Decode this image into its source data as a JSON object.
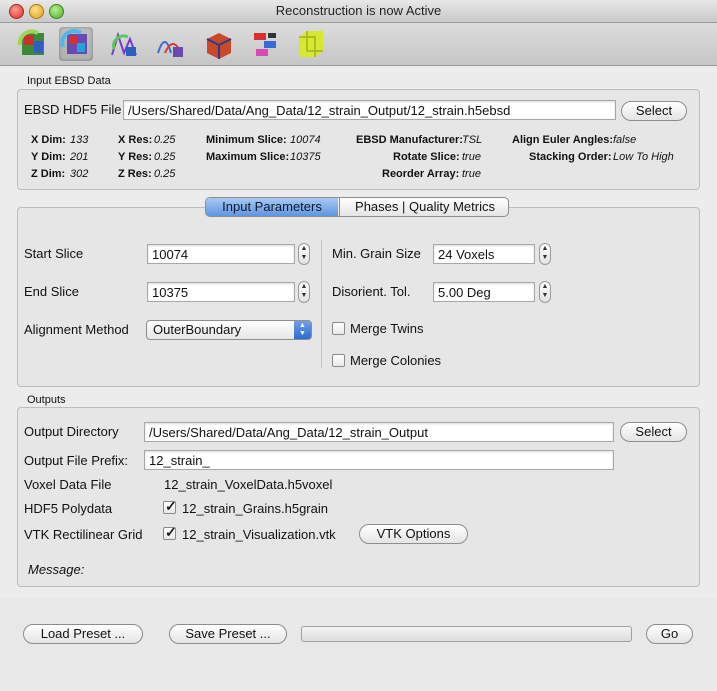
{
  "window": {
    "title": "Reconstruction is now Active"
  },
  "toolbar": {
    "tools": [
      "align-sections-tool",
      "reconstruction-tool",
      "grain-generator-tool",
      "microstructure-statistics-tool",
      "surface-mesh-tool",
      "volume-mesh-tool",
      "crystal-tool"
    ],
    "active_tool": "reconstruction-tool"
  },
  "input": {
    "group_title": "Input EBSD Data",
    "file_label": "EBSD HDF5 File",
    "file_value": "/Users/Shared/Data/Ang_Data/12_strain_Output/12_strain.h5ebsd",
    "select_label": "Select",
    "x_dim_label": "X Dim:",
    "x_dim": "133",
    "y_dim_label": "Y Dim:",
    "y_dim": "201",
    "z_dim_label": "Z Dim:",
    "z_dim": "302",
    "x_res_label": "X Res:",
    "x_res": "0.25",
    "y_res_label": "Y Res:",
    "y_res": "0.25",
    "z_res_label": "Z Res:",
    "z_res": "0.25",
    "min_slice_label": "Minimum Slice:",
    "min_slice": "10074",
    "max_slice_label": "Maximum Slice:",
    "max_slice": "10375",
    "manufacturer_label": "EBSD Manufacturer:",
    "manufacturer": "TSL",
    "rotate_label": "Rotate Slice:",
    "rotate": "true",
    "reorder_label": "Reorder Array:",
    "reorder": "true",
    "align_euler_label": "Align Euler Angles:",
    "align_euler": "false",
    "stacking_label": "Stacking Order:",
    "stacking": "Low To High"
  },
  "tabs": {
    "input_params": "Input Parameters",
    "phases": "Phases | Quality Metrics"
  },
  "params": {
    "start_slice_label": "Start Slice",
    "start_slice": "10074",
    "end_slice_label": "End Slice",
    "end_slice": "10375",
    "alignment_label": "Alignment Method",
    "alignment": "OuterBoundary",
    "min_grain_label": "Min. Grain Size",
    "min_grain": "24 Voxels",
    "disorient_label": "Disorient. Tol.",
    "disorient": "5.00 Deg",
    "merge_twins": "Merge Twins",
    "merge_colonies": "Merge Colonies"
  },
  "outputs": {
    "group_title": "Outputs",
    "dir_label": "Output Directory",
    "dir_value": "/Users/Shared/Data/Ang_Data/12_strain_Output",
    "select_label": "Select",
    "prefix_label": "Output File Prefix:",
    "prefix_value": "12_strain_",
    "voxel_label": "Voxel Data File",
    "voxel_value": "12_strain_VoxelData.h5voxel",
    "hdf5_label": "HDF5 Polydata",
    "hdf5_value": "12_strain_Grains.h5grain",
    "vtk_label": "VTK Rectilinear Grid",
    "vtk_value": "12_strain_Visualization.vtk",
    "vtk_options": "VTK Options",
    "message_label": "Message:"
  },
  "footer": {
    "load_preset": "Load Preset ...",
    "save_preset": "Save Preset ...",
    "go": "Go"
  }
}
